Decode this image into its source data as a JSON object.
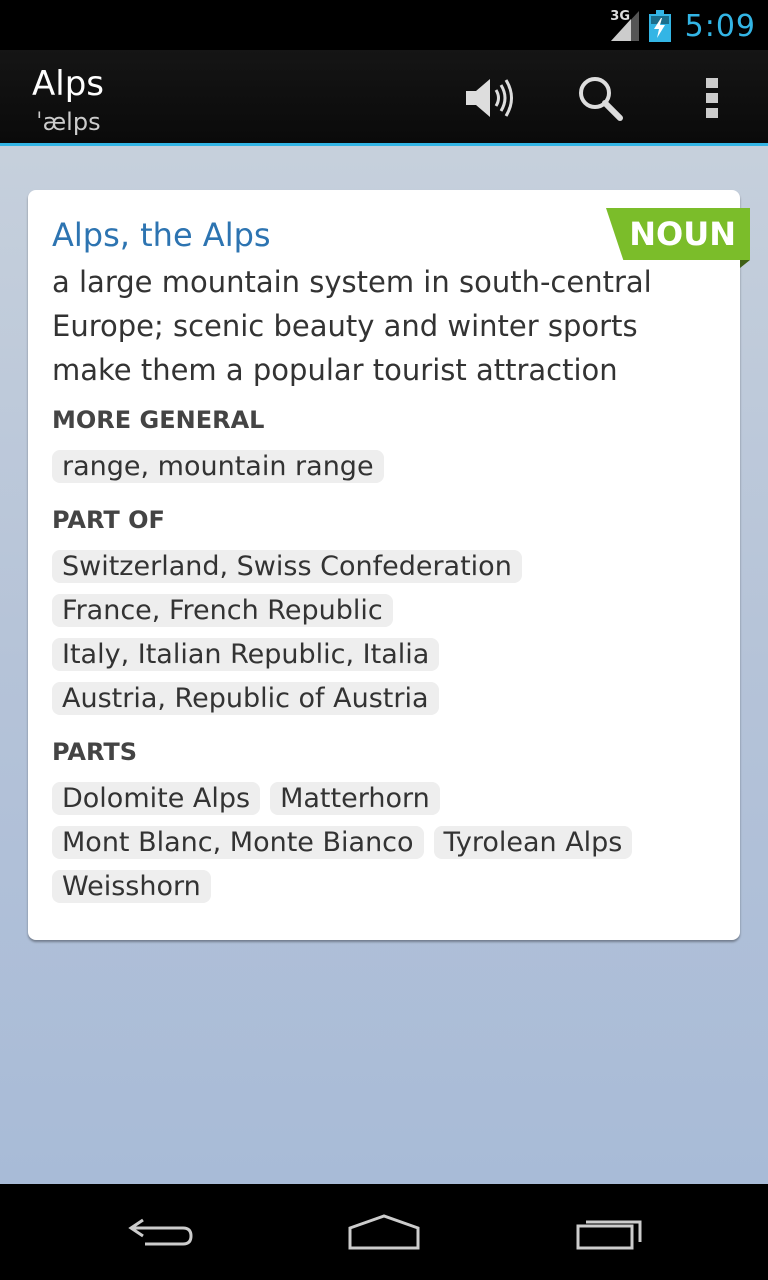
{
  "status": {
    "network": "3G",
    "time": "5:09"
  },
  "header": {
    "title": "Alps",
    "pronunciation": "ˈælps"
  },
  "entry": {
    "pos": "NOUN",
    "headword": "Alps, the Alps",
    "definition": "a large mountain system in south-central Europe; scenic beauty and winter sports make them a popular tourist attraction",
    "sections": {
      "more_general": {
        "label": "MORE GENERAL",
        "items": [
          "range, mountain range"
        ]
      },
      "part_of": {
        "label": "PART OF",
        "items": [
          "Switzerland, Swiss Confederation",
          "France, French Republic",
          "Italy, Italian Republic, Italia",
          "Austria, Republic of Austria"
        ]
      },
      "parts": {
        "label": "PARTS",
        "items": [
          "Dolomite Alps",
          "Matterhorn",
          "Mont Blanc, Monte Bianco",
          "Tyrolean Alps",
          "Weisshorn"
        ]
      }
    }
  },
  "colors": {
    "accent": "#33b5e5",
    "pos_tag": "#7bbd2a",
    "headword": "#2d74b1"
  },
  "icons": {
    "speak": "speaker-icon",
    "search": "search-icon",
    "menu": "overflow-menu-icon",
    "back": "back-icon",
    "home": "home-icon",
    "recent": "recent-apps-icon"
  }
}
